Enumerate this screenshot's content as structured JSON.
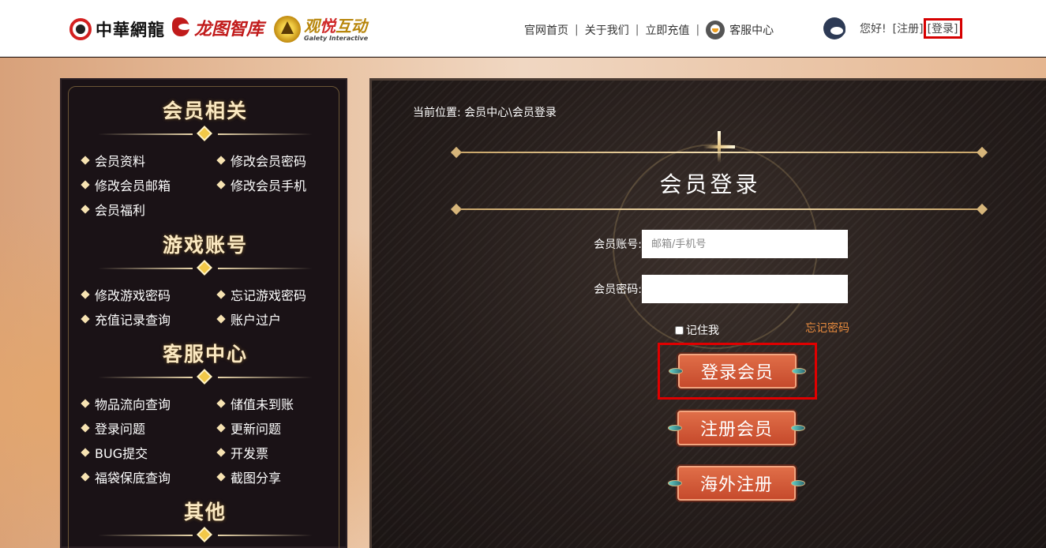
{
  "header": {
    "logos": {
      "zhonghua": "中華網龍",
      "longtu": "龙图智库",
      "guanyue_text_a": "观",
      "guanyue_text_b": "悦",
      "guanyue_text_c": "互动",
      "guanyue_sub": "Galety Interactive"
    },
    "nav": [
      "官网首页",
      "关于我们",
      "立即充值",
      "客服中心"
    ],
    "separator": "|",
    "greeting": "您好!",
    "register_link": "[注册]",
    "login_link": "[登录]"
  },
  "sidebar": {
    "sections": [
      {
        "title": "会员相关",
        "items": [
          "会员资料",
          "修改会员密码",
          "修改会员邮箱",
          "修改会员手机",
          "会员福利"
        ]
      },
      {
        "title": "游戏账号",
        "items": [
          "修改游戏密码",
          "忘记游戏密码",
          "充值记录查询",
          "账户过户"
        ]
      },
      {
        "title": "客服中心",
        "items": [
          "物品流向查询",
          "储值未到账",
          "登录问题",
          "更新问题",
          "BUG提交",
          "开发票",
          "福袋保底查询",
          "截图分享"
        ]
      },
      {
        "title": "其他",
        "items": []
      }
    ]
  },
  "main": {
    "breadcrumb": {
      "prefix": "当前位置:",
      "crumb1": "会员中心",
      "sep": "\\",
      "crumb2": "会员登录"
    },
    "title": "会员登录",
    "account_label": "会员账号:",
    "account_placeholder": "邮箱/手机号",
    "account_value": "",
    "password_label": "会员密码:",
    "password_value": "",
    "remember_label": "记住我",
    "forgot_label": "忘记密码",
    "buttons": {
      "login": "登录会员",
      "register": "注册会员",
      "overseas": "海外注册"
    }
  },
  "colors": {
    "highlight_red": "#e00000",
    "button_orange": "#d35a38",
    "forgot_orange": "#e88b3e"
  }
}
